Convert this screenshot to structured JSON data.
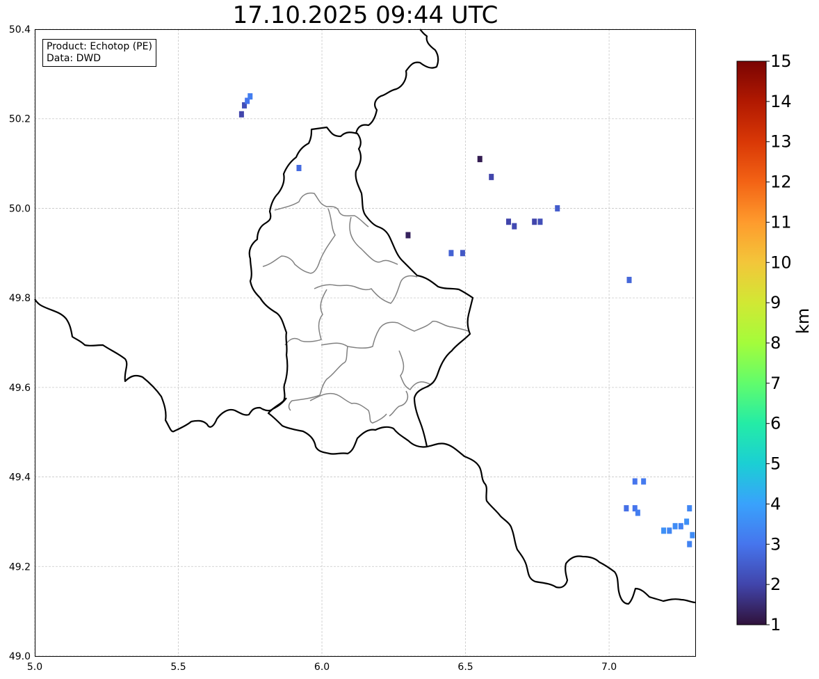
{
  "title": "17.10.2025 09:44 UTC",
  "info": {
    "product_label": "Product:",
    "product_value": "Echotop (PE)",
    "data_label": "Data:",
    "data_value": "DWD"
  },
  "map": {
    "lon_range": [
      5.0,
      7.3
    ],
    "lat_range": [
      49.0,
      50.4
    ],
    "x_ticks": [
      "5.0",
      "5.5",
      "6.0",
      "6.5",
      "7.0"
    ],
    "x_tick_values": [
      5.0,
      5.5,
      6.0,
      6.5,
      7.0
    ],
    "y_ticks": [
      "49.0",
      "49.2",
      "49.4",
      "49.6",
      "49.8",
      "50.0",
      "50.2",
      "50.4"
    ],
    "y_tick_values": [
      49.0,
      49.2,
      49.4,
      49.6,
      49.8,
      50.0,
      50.2,
      50.4
    ],
    "grid": true,
    "border_color": "#000000",
    "district_color": "#808080"
  },
  "radar_cells": [
    {
      "lon": 5.72,
      "lat": 50.21,
      "value": 2.0
    },
    {
      "lon": 5.73,
      "lat": 50.23,
      "value": 2.2
    },
    {
      "lon": 5.74,
      "lat": 50.24,
      "value": 3.0
    },
    {
      "lon": 5.75,
      "lat": 50.25,
      "value": 3.2
    },
    {
      "lon": 5.92,
      "lat": 50.09,
      "value": 2.8
    },
    {
      "lon": 6.55,
      "lat": 50.11,
      "value": 1.2
    },
    {
      "lon": 6.59,
      "lat": 50.07,
      "value": 2.0
    },
    {
      "lon": 6.3,
      "lat": 49.94,
      "value": 1.3
    },
    {
      "lon": 6.45,
      "lat": 49.9,
      "value": 2.6
    },
    {
      "lon": 6.49,
      "lat": 49.9,
      "value": 2.4
    },
    {
      "lon": 6.65,
      "lat": 49.97,
      "value": 2.0
    },
    {
      "lon": 6.67,
      "lat": 49.96,
      "value": 2.1
    },
    {
      "lon": 6.74,
      "lat": 49.97,
      "value": 2.0
    },
    {
      "lon": 6.76,
      "lat": 49.97,
      "value": 2.2
    },
    {
      "lon": 6.82,
      "lat": 50.0,
      "value": 2.5
    },
    {
      "lon": 7.07,
      "lat": 49.84,
      "value": 2.7
    },
    {
      "lon": 7.09,
      "lat": 49.39,
      "value": 3.0
    },
    {
      "lon": 7.12,
      "lat": 49.39,
      "value": 3.1
    },
    {
      "lon": 7.06,
      "lat": 49.33,
      "value": 2.9
    },
    {
      "lon": 7.09,
      "lat": 49.33,
      "value": 3.0
    },
    {
      "lon": 7.1,
      "lat": 49.32,
      "value": 3.2
    },
    {
      "lon": 7.21,
      "lat": 49.28,
      "value": 3.4
    },
    {
      "lon": 7.23,
      "lat": 49.29,
      "value": 3.5
    },
    {
      "lon": 7.25,
      "lat": 49.29,
      "value": 3.3
    },
    {
      "lon": 7.27,
      "lat": 49.3,
      "value": 3.6
    },
    {
      "lon": 7.28,
      "lat": 49.33,
      "value": 3.4
    },
    {
      "lon": 7.29,
      "lat": 49.27,
      "value": 3.5
    },
    {
      "lon": 7.28,
      "lat": 49.25,
      "value": 3.3
    },
    {
      "lon": 7.19,
      "lat": 49.28,
      "value": 3.6
    }
  ],
  "colorbar": {
    "label": "km",
    "min": 1,
    "max": 15,
    "ticks": [
      "1",
      "2",
      "3",
      "4",
      "5",
      "6",
      "7",
      "8",
      "9",
      "10",
      "11",
      "12",
      "13",
      "14",
      "15"
    ],
    "colormap_stops": [
      "#30123b",
      "#4145ab",
      "#4675ed",
      "#39a2fc",
      "#1bcfd4",
      "#24eca6",
      "#61fc6c",
      "#a4fc3b",
      "#d1e834",
      "#f3c63a",
      "#fe9b2d",
      "#f36315",
      "#d93806",
      "#b11901",
      "#7a0403"
    ]
  }
}
